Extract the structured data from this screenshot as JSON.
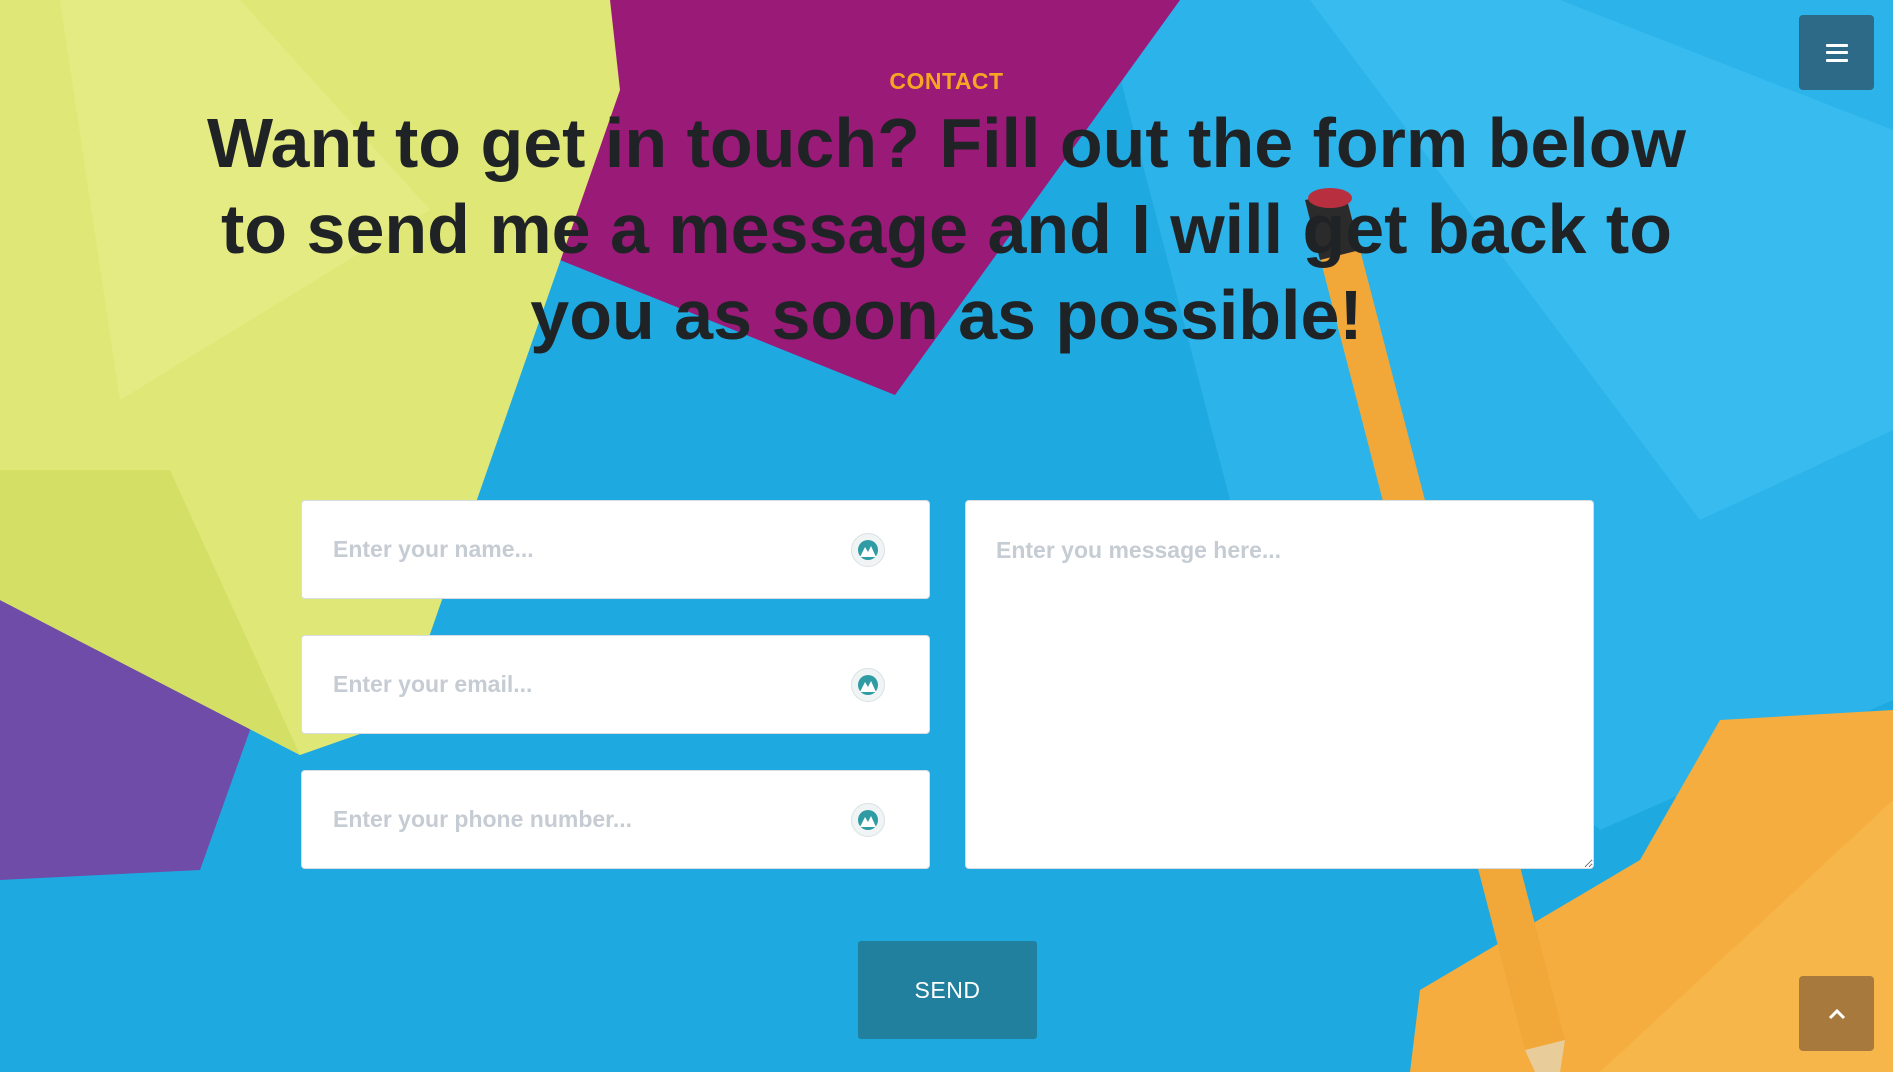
{
  "section": {
    "eyebrow": "CONTACT",
    "headline": "Want to get in touch? Fill out the form below to send me a message and I will get back to you as soon as possible!"
  },
  "form": {
    "name_placeholder": "Enter your name...",
    "email_placeholder": "Enter your email...",
    "phone_placeholder": "Enter your phone number...",
    "message_placeholder": "Enter you message here...",
    "field_icon": "mountain-badge-icon",
    "send_label": "SEND"
  },
  "nav": {
    "menu_icon": "hamburger-menu-icon",
    "scroll_top_icon": "chevron-up-icon"
  },
  "colors": {
    "eyebrow": "#f6a623",
    "headline": "#202326",
    "background": "#1ea9e0",
    "send_button": "#20809e",
    "menu_button": "#2c6a87",
    "scroll_top_button": "#a8793d"
  }
}
